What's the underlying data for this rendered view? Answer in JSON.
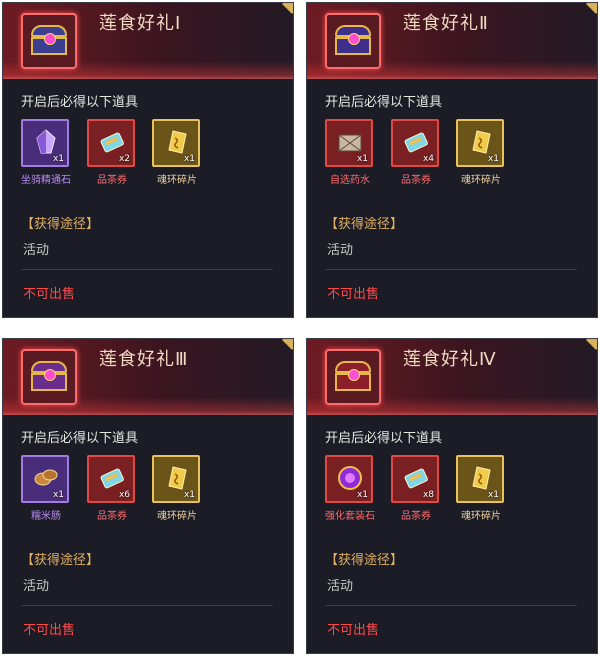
{
  "colors": {
    "panel_bg": "#1b1c26",
    "accent_red": "#ff4a4a",
    "source_label": "#e0b060",
    "rarity_purple": "#b98af2",
    "rarity_red": "#ff6a6a",
    "rarity_gold": "#f0d4a0"
  },
  "cards": [
    {
      "title": "莲食好礼Ⅰ",
      "subtitle": "开启后必得以下道具",
      "chest_color": "#3a3f8f",
      "items": [
        {
          "name": "坐骑精通石",
          "count": "x1",
          "rarity": "purple",
          "icon": "crystal-icon"
        },
        {
          "name": "品茶券",
          "count": "x2",
          "rarity": "red",
          "icon": "tea-ticket-icon"
        },
        {
          "name": "魂环碎片",
          "count": "x1",
          "rarity": "gold",
          "icon": "soul-ring-shard-icon"
        }
      ],
      "source_label": "【获得途径】",
      "source_value": "活动",
      "sell_status": "不可出售"
    },
    {
      "title": "莲食好礼Ⅱ",
      "subtitle": "开启后必得以下道具",
      "chest_color": "#3d2f8a",
      "items": [
        {
          "name": "自选药水",
          "count": "x1",
          "rarity": "red",
          "icon": "potion-crate-icon"
        },
        {
          "name": "品茶券",
          "count": "x4",
          "rarity": "red",
          "icon": "tea-ticket-icon"
        },
        {
          "name": "魂环碎片",
          "count": "x1",
          "rarity": "gold",
          "icon": "soul-ring-shard-icon"
        }
      ],
      "source_label": "【获得途径】",
      "source_value": "活动",
      "sell_status": "不可出售"
    },
    {
      "title": "莲食好礼Ⅲ",
      "subtitle": "开启后必得以下道具",
      "chest_color": "#6a2d8c",
      "items": [
        {
          "name": "糯米肠",
          "count": "x1",
          "rarity": "purple",
          "icon": "sausage-icon"
        },
        {
          "name": "品茶券",
          "count": "x6",
          "rarity": "red",
          "icon": "tea-ticket-icon"
        },
        {
          "name": "魂环碎片",
          "count": "x1",
          "rarity": "gold",
          "icon": "soul-ring-shard-icon"
        }
      ],
      "source_label": "【获得途径】",
      "source_value": "活动",
      "sell_status": "不可出售"
    },
    {
      "title": "莲食好礼Ⅳ",
      "subtitle": "开启后必得以下道具",
      "chest_color": "#8c1f2a",
      "items": [
        {
          "name": "强化套装石",
          "count": "x1",
          "rarity": "red",
          "icon": "enhance-orb-icon"
        },
        {
          "name": "品茶券",
          "count": "x8",
          "rarity": "red",
          "icon": "tea-ticket-icon"
        },
        {
          "name": "魂环碎片",
          "count": "x1",
          "rarity": "gold",
          "icon": "soul-ring-shard-icon"
        }
      ],
      "source_label": "【获得途径】",
      "source_value": "活动",
      "sell_status": "不可出售"
    }
  ]
}
